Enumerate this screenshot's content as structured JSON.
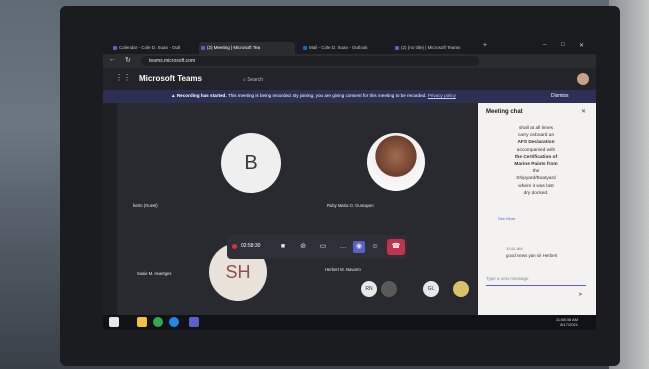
{
  "browser": {
    "tabs": [
      {
        "label": "Calendar - Cole D. Suan - Outl"
      },
      {
        "label": "(2) Meeting | Microsoft Tea"
      },
      {
        "label": "Mail - Cole D. Suan - Outlook"
      },
      {
        "label": "(2) (no title) | Microsoft Teams"
      }
    ],
    "url": "teams.microsoft.com"
  },
  "teams": {
    "app_title": "Microsoft Teams",
    "search_placeholder": "Search"
  },
  "banner": {
    "bold": "Recording has started.",
    "text": "This meeting is being recorded. By joining, you are giving consent for this meeting to be recorded.",
    "link": "Privacy policy",
    "dismiss": "Dismiss"
  },
  "participants": [
    {
      "initials": "B",
      "name": "berto (Guest)"
    },
    {
      "initials": "",
      "name": "Ruby Maria O. Gumapon"
    },
    {
      "initials": "SH",
      "name": "Susie M. Huertges"
    },
    {
      "initials": "",
      "name": "Herbert M. Navarro"
    }
  ],
  "callbar": {
    "timer": "02:58:30"
  },
  "mini_avatars": [
    "RN",
    "GL"
  ],
  "chat": {
    "title": "Meeting chat",
    "message_lines": [
      "shall at all times",
      "carry onboard an",
      "AFS Declaration",
      "accompanied with",
      "the Certification of",
      "Marine Paints from",
      "the",
      "Shipyard/Boatyard",
      "where it was last",
      "dry docked."
    ],
    "see_more": "See More",
    "reply_time": "11:51 AM",
    "reply_text": "good news yan sir Herbert",
    "input_placeholder": "Type a new message"
  },
  "taskbar": {
    "time": "11:58:38 AM",
    "date": "8/17/2021"
  }
}
